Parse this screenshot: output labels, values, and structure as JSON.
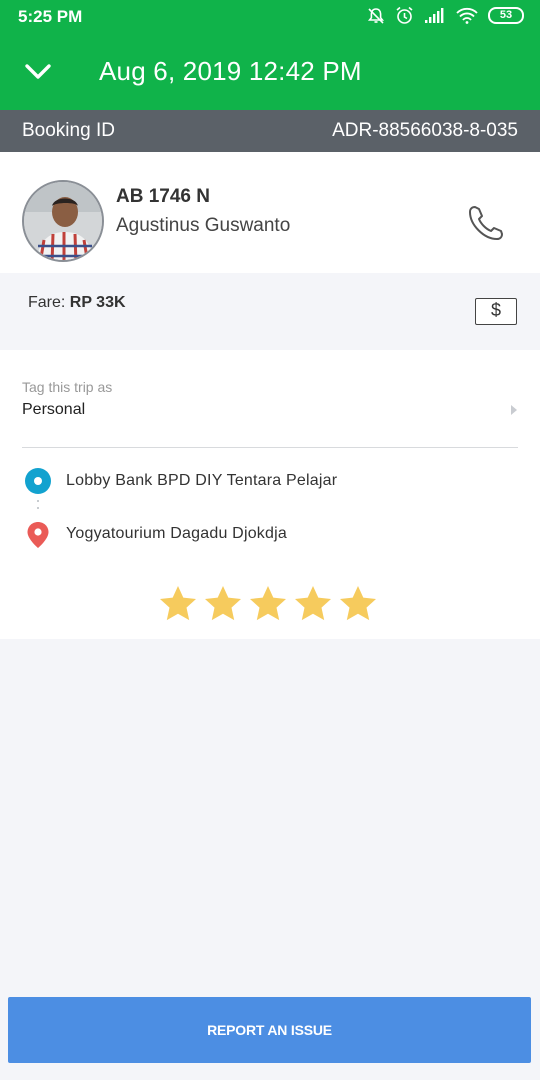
{
  "status_bar": {
    "time": "5:25 PM",
    "battery": "53",
    "icons": [
      "notifications-off-icon",
      "alarm-icon",
      "signal-icon",
      "wifi-icon",
      "battery-icon"
    ]
  },
  "header": {
    "title": "Aug 6, 2019 12:42 PM",
    "collapse_icon": "chevron-down-icon"
  },
  "booking": {
    "label": "Booking ID",
    "id": "ADR-88566038-8-035"
  },
  "driver": {
    "plate": "AB 1746 N",
    "name": "Agustinus Guswanto",
    "call_icon": "phone-icon"
  },
  "fare": {
    "label": "Fare:",
    "amount": "RP 33K",
    "icon_symbol": "$"
  },
  "tag": {
    "label": "Tag this trip as",
    "value": "Personal"
  },
  "route": {
    "pickup": "Lobby Bank BPD DIY Tentara Pelajar",
    "dropoff": "Yogyatourium Dagadu Djokdja"
  },
  "rating": {
    "stars": 5,
    "max": 5
  },
  "actions": {
    "report_label": "REPORT AN ISSUE"
  },
  "colors": {
    "primary_green": "#10b34a",
    "booking_bar": "#5b6168",
    "star": "#f6cb5d",
    "pickup": "#12a2cf",
    "dropoff": "#ea5b57",
    "report_button": "#4c8ee3"
  }
}
